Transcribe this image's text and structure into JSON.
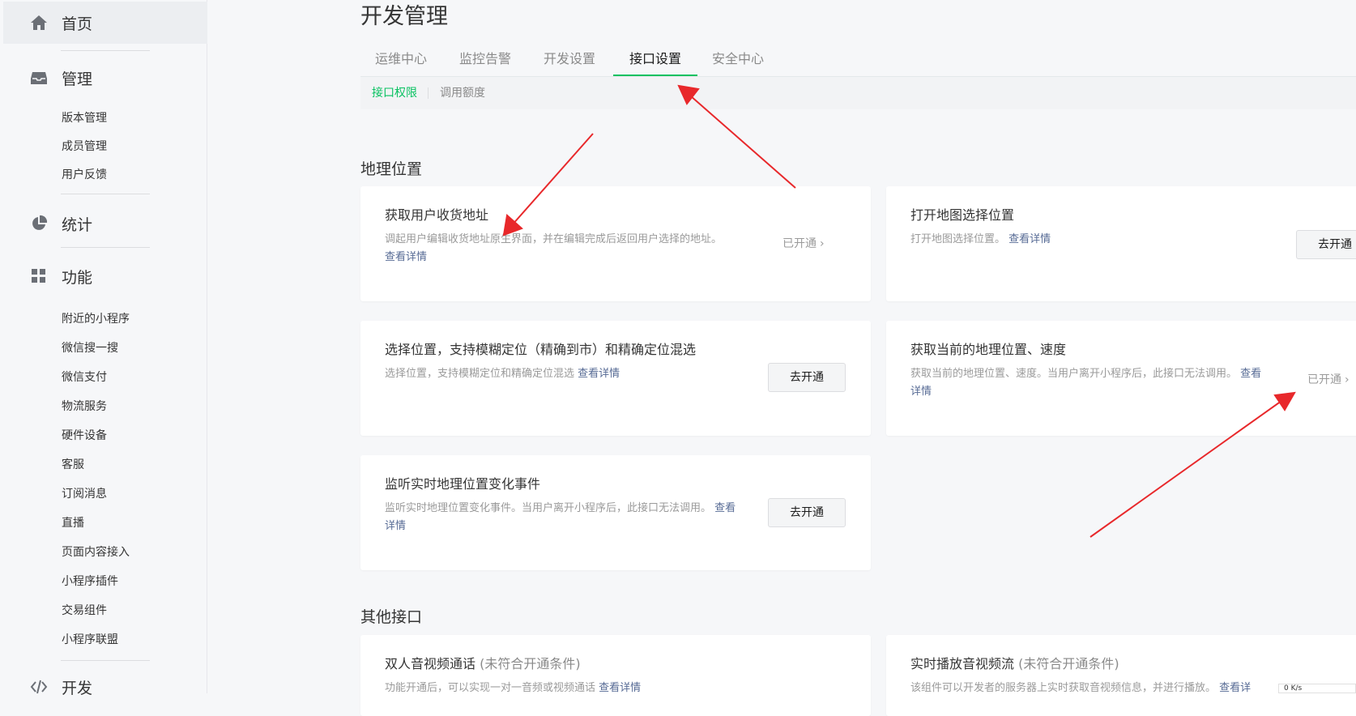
{
  "sidebar": {
    "home": "首页",
    "manage": "管理",
    "manage_items": [
      "版本管理",
      "成员管理",
      "用户反馈"
    ],
    "stats": "统计",
    "features": "功能",
    "feature_items": [
      "附近的小程序",
      "微信搜一搜",
      "微信支付",
      "物流服务",
      "硬件设备",
      "客服",
      "订阅消息",
      "直播",
      "页面内容接入",
      "小程序插件",
      "交易组件",
      "小程序联盟"
    ],
    "dev": "开发"
  },
  "page": {
    "title": "开发管理",
    "tabs": [
      "运维中心",
      "监控告警",
      "开发设置",
      "接口设置",
      "安全中心"
    ],
    "active_tab": "接口设置",
    "subtabs": [
      "接口权限",
      "调用额度"
    ]
  },
  "geo": {
    "section_title": "地理位置",
    "cards": [
      {
        "title": "获取用户收货地址",
        "desc": "调起用户编辑收货地址原生界面，并在编辑完成后返回用户选择的地址。",
        "link": "查看详情",
        "status": "已开通"
      },
      {
        "title": "打开地图选择位置",
        "desc": "打开地图选择位置。",
        "link": "查看详情",
        "button": "去开通"
      },
      {
        "title": "选择位置，支持模糊定位（精确到市）和精确定位混选",
        "desc": "选择位置，支持模糊定位和精确定位混选",
        "link": "查看详情",
        "button": "去开通"
      },
      {
        "title": "获取当前的地理位置、速度",
        "desc": "获取当前的地理位置、速度。当用户离开小程序后，此接口无法调用。",
        "link": "查看详情",
        "status": "已开通"
      },
      {
        "title": "监听实时地理位置变化事件",
        "desc": "监听实时地理位置变化事件。当用户离开小程序后，此接口无法调用。",
        "link": "查看详情",
        "button": "去开通"
      }
    ]
  },
  "other": {
    "section_title": "其他接口",
    "cards": [
      {
        "title": "双人音视频通话",
        "cond": "(未符合开通条件)",
        "desc": "功能开通后，可以实现一对一音频或视频通话",
        "link": "查看详情"
      },
      {
        "title": "实时播放音视频流",
        "cond": "(未符合开通条件)",
        "desc": "该组件可以开发者的服务器上实时获取音视频信息，并进行播放。",
        "link": "查看详"
      }
    ]
  },
  "status_bar": {
    "text": "0 K/s"
  },
  "colors": {
    "accent": "#07c160",
    "link": "#576b95",
    "arrow": "#e8282b"
  }
}
